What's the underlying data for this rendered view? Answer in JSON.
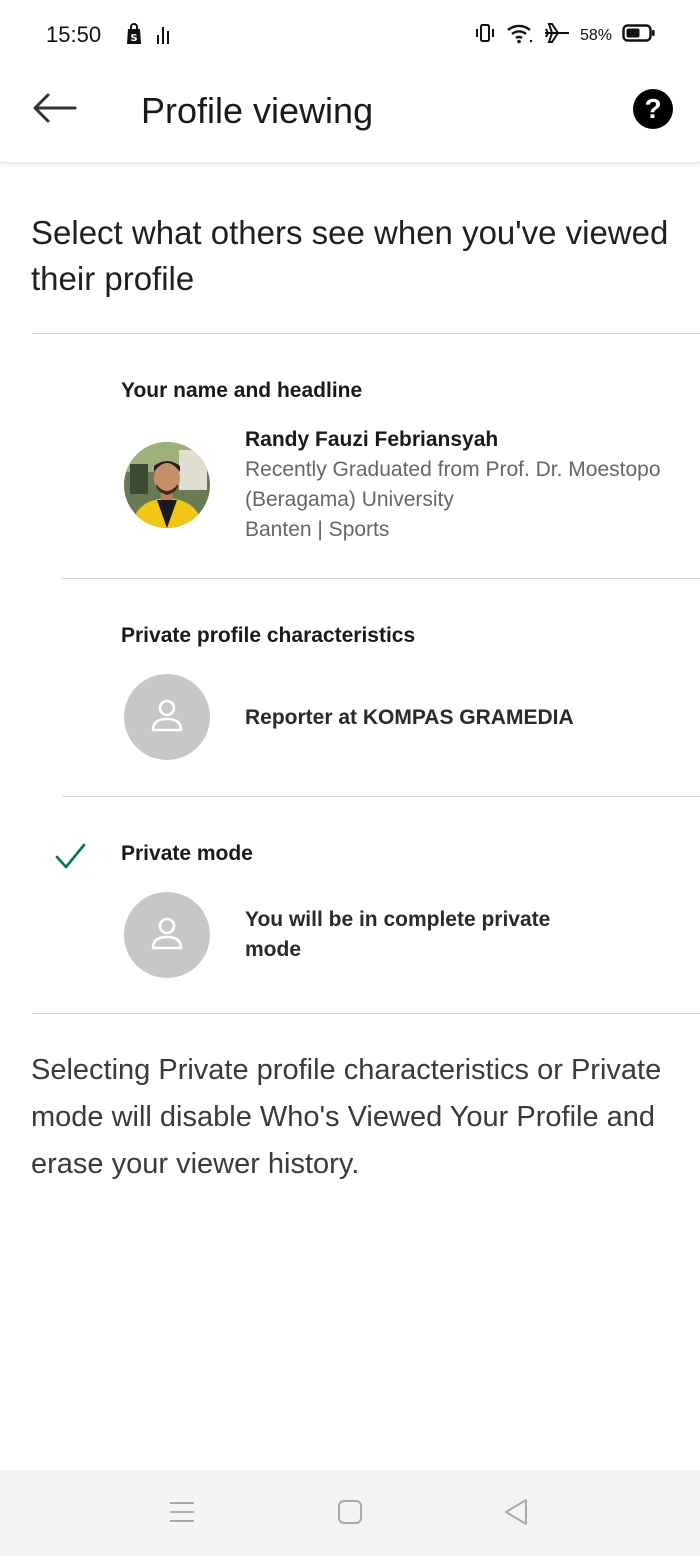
{
  "status_bar": {
    "time": "15:50",
    "battery": "58%",
    "icons": [
      "shopping-bag-icon",
      "signal-bars-icon",
      "vibrate-icon",
      "wifi-icon",
      "airplane-icon",
      "battery-icon"
    ]
  },
  "app_bar": {
    "title": "Profile viewing",
    "back_icon": "arrow-left-icon",
    "help_icon": "question-icon"
  },
  "intro": "Select what others see when you've viewed their profile",
  "options": [
    {
      "label": "Your name and headline",
      "selected": false,
      "name": "Randy Fauzi Febriansyah",
      "headline": "Recently Graduated from Prof. Dr. Moestopo (Beragama) University",
      "location": "Banten | Sports"
    },
    {
      "label": "Private profile characteristics",
      "selected": false,
      "description": "Reporter at KOMPAS GRAMEDIA"
    },
    {
      "label": "Private mode",
      "selected": true,
      "description": "You will be in complete private mode"
    }
  ],
  "footer_note": "Selecting Private profile characteristics or Private mode will disable Who's Viewed Your Profile and erase your viewer history.",
  "colors": {
    "check": "#057642",
    "avatar_placeholder": "#c7c7c7",
    "divider": "#d9d9d9"
  },
  "nav_bar": {
    "icons": [
      "menu-icon",
      "home-square-icon",
      "back-triangle-icon"
    ]
  }
}
